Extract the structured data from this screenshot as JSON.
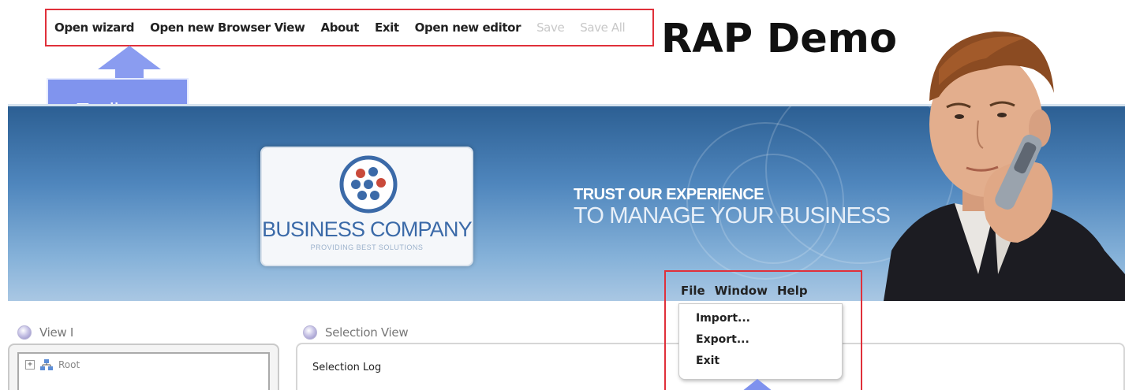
{
  "toolbar": {
    "items": [
      {
        "label": "Open wizard",
        "enabled": true
      },
      {
        "label": "Open new Browser View",
        "enabled": true
      },
      {
        "label": "About",
        "enabled": true
      },
      {
        "label": "Exit",
        "enabled": true
      },
      {
        "label": "Open new editor",
        "enabled": true
      },
      {
        "label": "Save",
        "enabled": false
      },
      {
        "label": "Save All",
        "enabled": false
      }
    ]
  },
  "title": "RAP Demo",
  "callout": {
    "label": "Toolbar",
    "color": "#8094ee"
  },
  "banner": {
    "company": "BUSINESS COMPANY",
    "tagline": "PROVIDING BEST SOLUTIONS",
    "slogan_line1": "TRUST OUR EXPERIENCE",
    "slogan_line2": "TO MANAGE YOUR BUSINESS"
  },
  "views": {
    "left": {
      "title": "View I",
      "tree_root": "Root",
      "expander": "+"
    },
    "right": {
      "title": "Selection View",
      "content": "Selection Log"
    }
  },
  "menu": {
    "bar": [
      "File",
      "Window",
      "Help"
    ],
    "file_items": [
      "Import...",
      "Export...",
      "Exit"
    ]
  },
  "colors": {
    "highlight_border": "#e0303a",
    "banner_top": "#2c5f93",
    "banner_bottom": "#a9c7e3"
  }
}
